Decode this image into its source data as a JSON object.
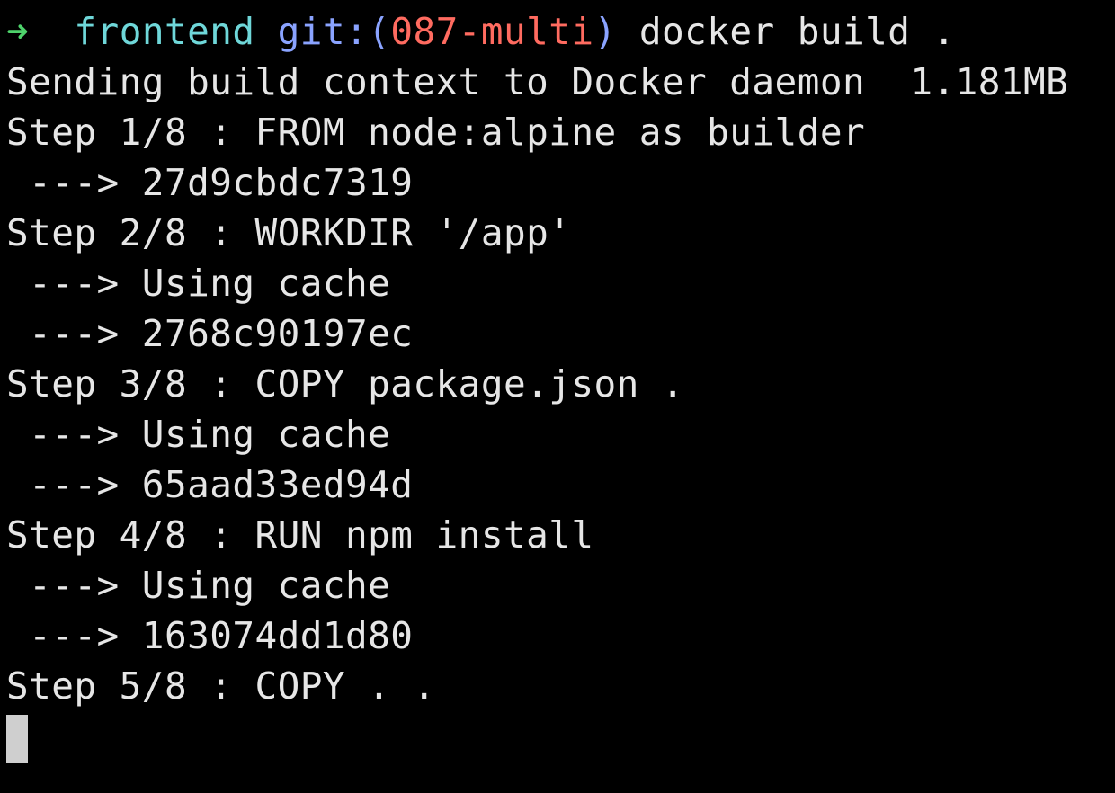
{
  "prompt": {
    "arrow": "➜",
    "directory": "frontend",
    "git_label": "git:(",
    "branch": "087-multi",
    "git_close": ")",
    "command": "docker build ."
  },
  "output_lines": [
    "Sending build context to Docker daemon  1.181MB",
    "Step 1/8 : FROM node:alpine as builder",
    " ---> 27d9cbdc7319",
    "Step 2/8 : WORKDIR '/app'",
    " ---> Using cache",
    " ---> 2768c90197ec",
    "Step 3/8 : COPY package.json .",
    " ---> Using cache",
    " ---> 65aad33ed94d",
    "Step 4/8 : RUN npm install",
    " ---> Using cache",
    " ---> 163074dd1d80",
    "Step 5/8 : COPY . ."
  ],
  "colors": {
    "background": "#000000",
    "text": "#e6e6e6",
    "prompt_arrow": "#4ed36b",
    "directory": "#6fd7d9",
    "git": "#8aa3ff",
    "branch": "#ff6b60",
    "cursor": "#cfcfcf"
  }
}
